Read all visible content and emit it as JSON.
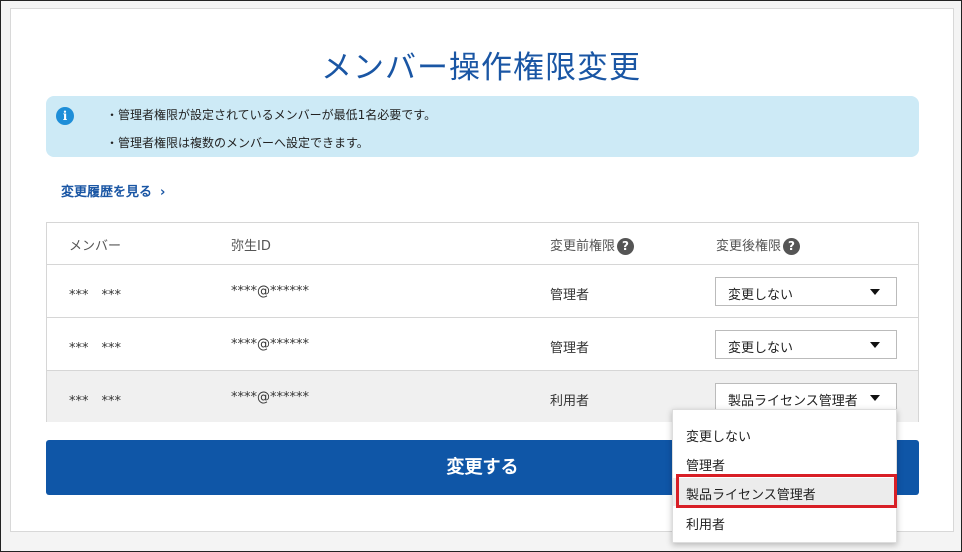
{
  "page_title": "メンバー操作権限変更",
  "notice": {
    "icon": "info-icon",
    "lines": [
      "・管理者権限が設定されているメンバーが最低1名必要です。",
      "・管理者権限は複数のメンバーへ設定できます。"
    ]
  },
  "history_link": {
    "label": "変更履歴を見る",
    "chevron": "›"
  },
  "table": {
    "headers": {
      "member": "メンバー",
      "yayoi_id": "弥生ID",
      "before": "変更前権限",
      "after": "変更後権限",
      "help": "?"
    },
    "rows": [
      {
        "member": "***　***",
        "id": "****@******",
        "before": "管理者",
        "after": "変更しない"
      },
      {
        "member": "***　***",
        "id": "****@******",
        "before": "管理者",
        "after": "変更しない"
      },
      {
        "member": "***　***",
        "id": "****@******",
        "before": "利用者",
        "after": "製品ライセンス管理者"
      }
    ]
  },
  "submit_label": "変更する",
  "dropdown": {
    "options": [
      "変更しない",
      "管理者",
      "製品ライセンス管理者",
      "利用者"
    ],
    "highlighted": "製品ライセンス管理者"
  },
  "colors": {
    "accent": "#1a56a4",
    "button": "#0f56a7",
    "notice_bg": "#cdeaf6",
    "highlight_border": "#d81f26"
  }
}
